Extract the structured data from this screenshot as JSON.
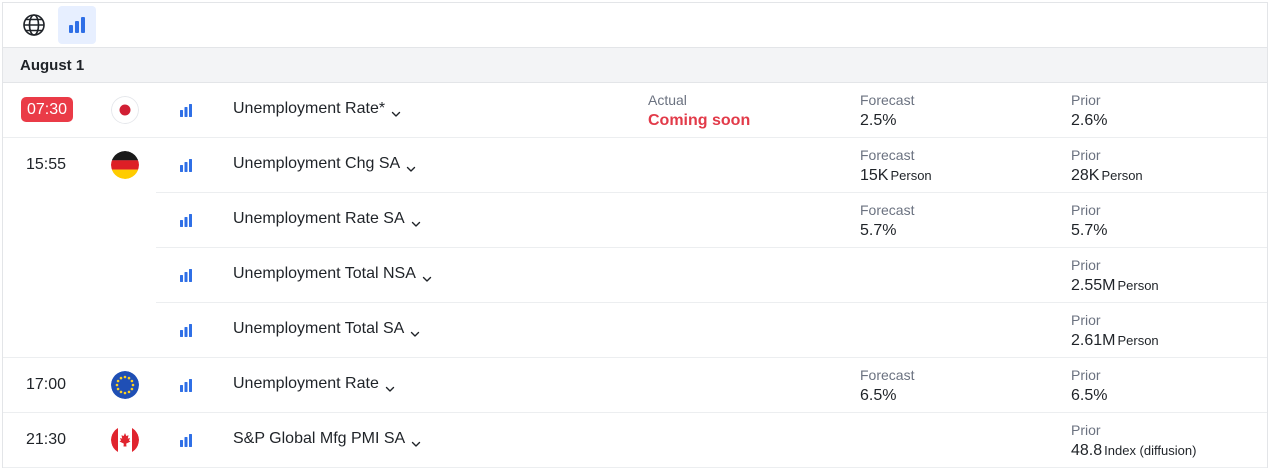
{
  "toolbar": {
    "buttons": [
      {
        "icon": "globe-icon"
      },
      {
        "icon": "bar-chart-icon",
        "active": true
      }
    ]
  },
  "date_header": "August 1",
  "labels": {
    "actual": "Actual",
    "forecast": "Forecast",
    "prior": "Prior"
  },
  "colors": {
    "accent": "#2f6fe6",
    "live_badge": "#ea3b47",
    "coming_soon": "#e23a49",
    "date_bg": "#f3f4f6"
  },
  "rows": [
    {
      "time": "07:30",
      "live": true,
      "flag": "japan",
      "name": "Unemployment Rate*",
      "actual": "Coming soon",
      "forecast": "2.5%",
      "forecast_unit": "",
      "prior": "2.6%",
      "prior_unit": ""
    },
    {
      "time": "15:55",
      "flag": "germany",
      "name": "Unemployment Chg SA",
      "forecast": "15K",
      "forecast_unit": "Person",
      "prior": "28K",
      "prior_unit": "Person"
    },
    {
      "time": "",
      "flag": "",
      "name": "Unemployment Rate SA",
      "forecast": "5.7%",
      "forecast_unit": "",
      "prior": "5.7%",
      "prior_unit": ""
    },
    {
      "time": "",
      "flag": "",
      "name": "Unemployment Total NSA",
      "prior": "2.55M",
      "prior_unit": "Person"
    },
    {
      "time": "",
      "flag": "",
      "name": "Unemployment Total SA",
      "prior": "2.61M",
      "prior_unit": "Person"
    },
    {
      "time": "17:00",
      "flag": "eu",
      "name": "Unemployment Rate",
      "forecast": "6.5%",
      "forecast_unit": "",
      "prior": "6.5%",
      "prior_unit": ""
    },
    {
      "time": "21:30",
      "flag": "canada",
      "name": "S&P Global Mfg PMI SA",
      "prior": "48.8",
      "prior_unit": "Index (diffusion)"
    }
  ]
}
